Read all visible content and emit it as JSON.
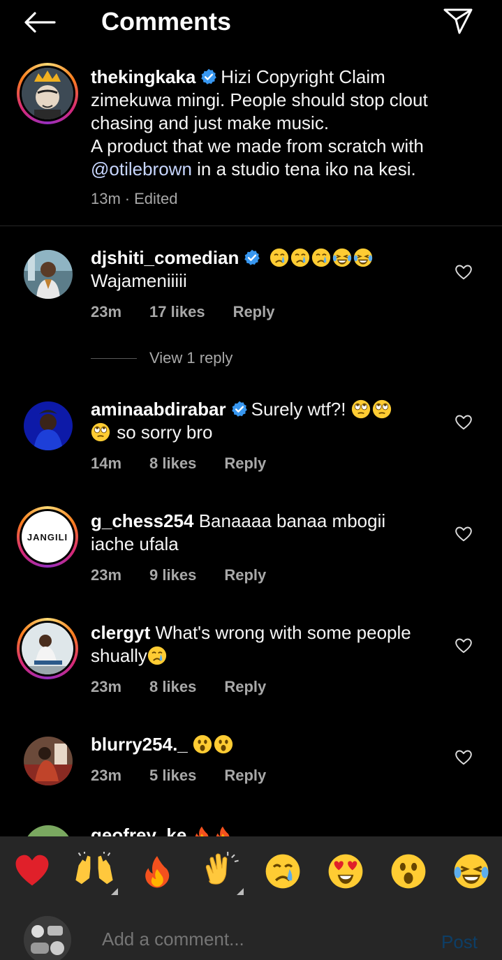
{
  "header": {
    "title": "Comments",
    "back_icon": "arrow-left-icon",
    "send_icon": "paper-plane-icon"
  },
  "caption": {
    "username": "thekingkaka",
    "text_line1": "Hizi Copyright Claim",
    "text_line2": "zimekuwa mingi. People should stop clout",
    "text_line3": "chasing and just make music.",
    "text_line4": "A product that we made from scratch with",
    "mention": "@otilebrown",
    "text_line5": " in a studio tena iko na kesi.",
    "time": "13m",
    "separator": "·",
    "edited": "Edited"
  },
  "comments": [
    {
      "username": "djshiti_comedian",
      "verified": true,
      "text": "Wajameniiiii",
      "emojis": [
        "crying-face",
        "crying-face",
        "crying-face",
        "laughing-tears",
        "laughing-tears"
      ],
      "time": "23m",
      "likes": "17 likes",
      "reply": "Reply"
    },
    {
      "username": "aminaabdirabar",
      "verified": true,
      "text_a": "Surely wtf?!",
      "text_b": "so sorry bro",
      "time": "14m",
      "likes": "8 likes",
      "reply": "Reply"
    },
    {
      "username": "g_chess254",
      "verified": false,
      "text_a": "Banaaaa banaa  mbogii",
      "text_b": "iache ufala",
      "avatar_text": "JANGILI",
      "time": "23m",
      "likes": "9 likes",
      "reply": "Reply"
    },
    {
      "username": "clergyt",
      "verified": false,
      "text_a": "What's wrong with some people",
      "text_b": "shually",
      "time": "23m",
      "likes": "8 likes",
      "reply": "Reply"
    },
    {
      "username": "blurry254._",
      "verified": false,
      "text_a": "",
      "time": "23m",
      "likes": "5 likes",
      "reply": "Reply"
    },
    {
      "username": "geofrey_ke",
      "verified": false,
      "text_a": ""
    }
  ],
  "view_replies": "View 1 reply",
  "emoji_bar": [
    "red-heart",
    "raising-hands",
    "fire",
    "clapping-hands",
    "crying-face",
    "heart-eyes",
    "astonished-face",
    "laughing-tears"
  ],
  "input": {
    "placeholder": "Add a comment...",
    "post_label": "Post"
  },
  "colors": {
    "background": "#000000",
    "panel": "#262626",
    "muted_text": "#a8a8a8",
    "verified_blue": "#3897f0",
    "post_disabled": "#0d3e66"
  }
}
